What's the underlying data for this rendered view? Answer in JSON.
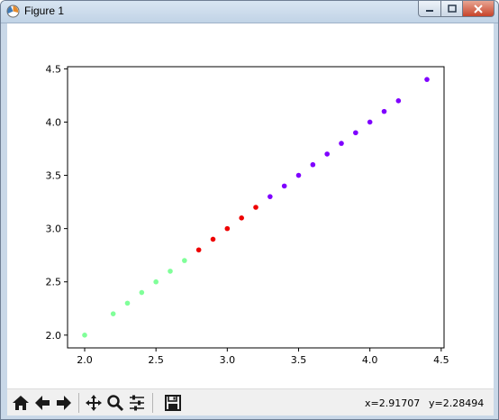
{
  "window": {
    "title": "Figure 1"
  },
  "toolbar": {
    "buttons": [
      {
        "name": "home-button",
        "icon": "home-icon"
      },
      {
        "name": "back-button",
        "icon": "arrow-left-icon"
      },
      {
        "name": "forward-button",
        "icon": "arrow-right-icon"
      },
      {
        "name": "pan-button",
        "icon": "move-icon"
      },
      {
        "name": "zoom-button",
        "icon": "magnifier-icon"
      },
      {
        "name": "configure-subplots-button",
        "icon": "sliders-icon"
      },
      {
        "name": "save-button",
        "icon": "floppy-disk-icon"
      }
    ],
    "x_readout": "x=2.91707",
    "y_readout": "y=2.28494"
  },
  "colors": {
    "green": "#80ff99",
    "red": "#ee0000",
    "purple": "#7f00ff"
  },
  "chart_data": {
    "type": "scatter",
    "title": "",
    "xlabel": "",
    "ylabel": "",
    "xlim": [
      1.88,
      4.52
    ],
    "ylim": [
      1.88,
      4.52
    ],
    "xticks": [
      "2.0",
      "2.5",
      "3.0",
      "3.5",
      "4.0",
      "4.5"
    ],
    "yticks": [
      "2.0",
      "2.5",
      "3.0",
      "3.5",
      "4.0",
      "4.5"
    ],
    "grid": false,
    "points": [
      {
        "x": 2.0,
        "y": 2.0,
        "color": "#80ff99"
      },
      {
        "x": 2.2,
        "y": 2.2,
        "color": "#80ff99"
      },
      {
        "x": 2.3,
        "y": 2.3,
        "color": "#80ff99"
      },
      {
        "x": 2.4,
        "y": 2.4,
        "color": "#80ff99"
      },
      {
        "x": 2.5,
        "y": 2.5,
        "color": "#80ff99"
      },
      {
        "x": 2.6,
        "y": 2.6,
        "color": "#80ff99"
      },
      {
        "x": 2.7,
        "y": 2.7,
        "color": "#80ff99"
      },
      {
        "x": 2.8,
        "y": 2.8,
        "color": "#ee0000"
      },
      {
        "x": 2.9,
        "y": 2.9,
        "color": "#ee0000"
      },
      {
        "x": 3.0,
        "y": 3.0,
        "color": "#ee0000"
      },
      {
        "x": 3.1,
        "y": 3.1,
        "color": "#ee0000"
      },
      {
        "x": 3.2,
        "y": 3.2,
        "color": "#ee0000"
      },
      {
        "x": 3.3,
        "y": 3.3,
        "color": "#7f00ff"
      },
      {
        "x": 3.4,
        "y": 3.4,
        "color": "#7f00ff"
      },
      {
        "x": 3.5,
        "y": 3.5,
        "color": "#7f00ff"
      },
      {
        "x": 3.6,
        "y": 3.6,
        "color": "#7f00ff"
      },
      {
        "x": 3.7,
        "y": 3.7,
        "color": "#7f00ff"
      },
      {
        "x": 3.8,
        "y": 3.8,
        "color": "#7f00ff"
      },
      {
        "x": 3.9,
        "y": 3.9,
        "color": "#7f00ff"
      },
      {
        "x": 4.0,
        "y": 4.0,
        "color": "#7f00ff"
      },
      {
        "x": 4.1,
        "y": 4.1,
        "color": "#7f00ff"
      },
      {
        "x": 4.2,
        "y": 4.2,
        "color": "#7f00ff"
      },
      {
        "x": 4.4,
        "y": 4.4,
        "color": "#7f00ff"
      }
    ]
  }
}
